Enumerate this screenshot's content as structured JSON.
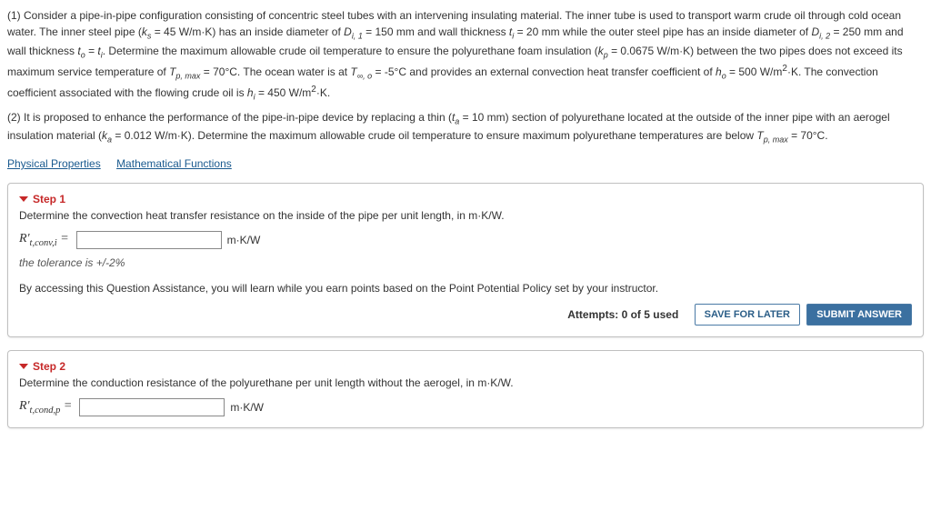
{
  "problem": {
    "part1": "(1) Consider a pipe-in-pipe configuration consisting of concentric steel tubes with an intervening insulating material. The inner tube is used to transport warm crude oil through cold ocean water. The inner steel pipe (kₛ = 45 W/m·K) has an inside diameter of D_{i,1} = 150 mm and wall thickness t_i = 20 mm while the outer steel pipe has an inside diameter of D_{i,2} = 250 mm and wall thickness t_o = t_i. Determine the maximum allowable crude oil temperature to ensure the polyurethane foam insulation (k_p = 0.0675 W/m·K) between the two pipes does not exceed its maximum service temperature of T_{p, max} = 70°C. The ocean water is at T_{∞,o} = -5°C and provides an external convection heat transfer coefficient of h_o = 500 W/m²·K. The convection coefficient associated with the flowing crude oil is h_i = 450 W/m²·K.",
    "part2": "(2) It is proposed to enhance the performance of the pipe-in-pipe device by replacing a thin (t_a = 10 mm) section of polyurethane located at the outside of the inner pipe with an aerogel insulation material (k_a = 0.012 W/m·K). Determine the maximum allowable crude oil temperature to ensure maximum polyurethane temperatures are below T_{p, max} = 70°C."
  },
  "links": {
    "physical": "Physical Properties",
    "math": "Mathematical Functions"
  },
  "step1": {
    "label": "Step 1",
    "instruct": "Determine the convection heat transfer resistance on the inside of the pipe per unit length, in m·K/W.",
    "var_html": "R'_{t,conv,i} =",
    "unit": "m·K/W",
    "tol": "the tolerance is +/-2%",
    "disclaimer": "By accessing this Question Assistance, you will learn while you earn points based on the Point Potential Policy set by your instructor.",
    "attempts": "Attempts: 0 of 5 used",
    "save": "SAVE FOR LATER",
    "submit": "SUBMIT ANSWER"
  },
  "step2": {
    "label": "Step 2",
    "instruct": "Determine the conduction resistance of the polyurethane per unit length without the aerogel, in m·K/W.",
    "var_html": "R'_{t,cond,p} =",
    "unit": "m·K/W"
  }
}
